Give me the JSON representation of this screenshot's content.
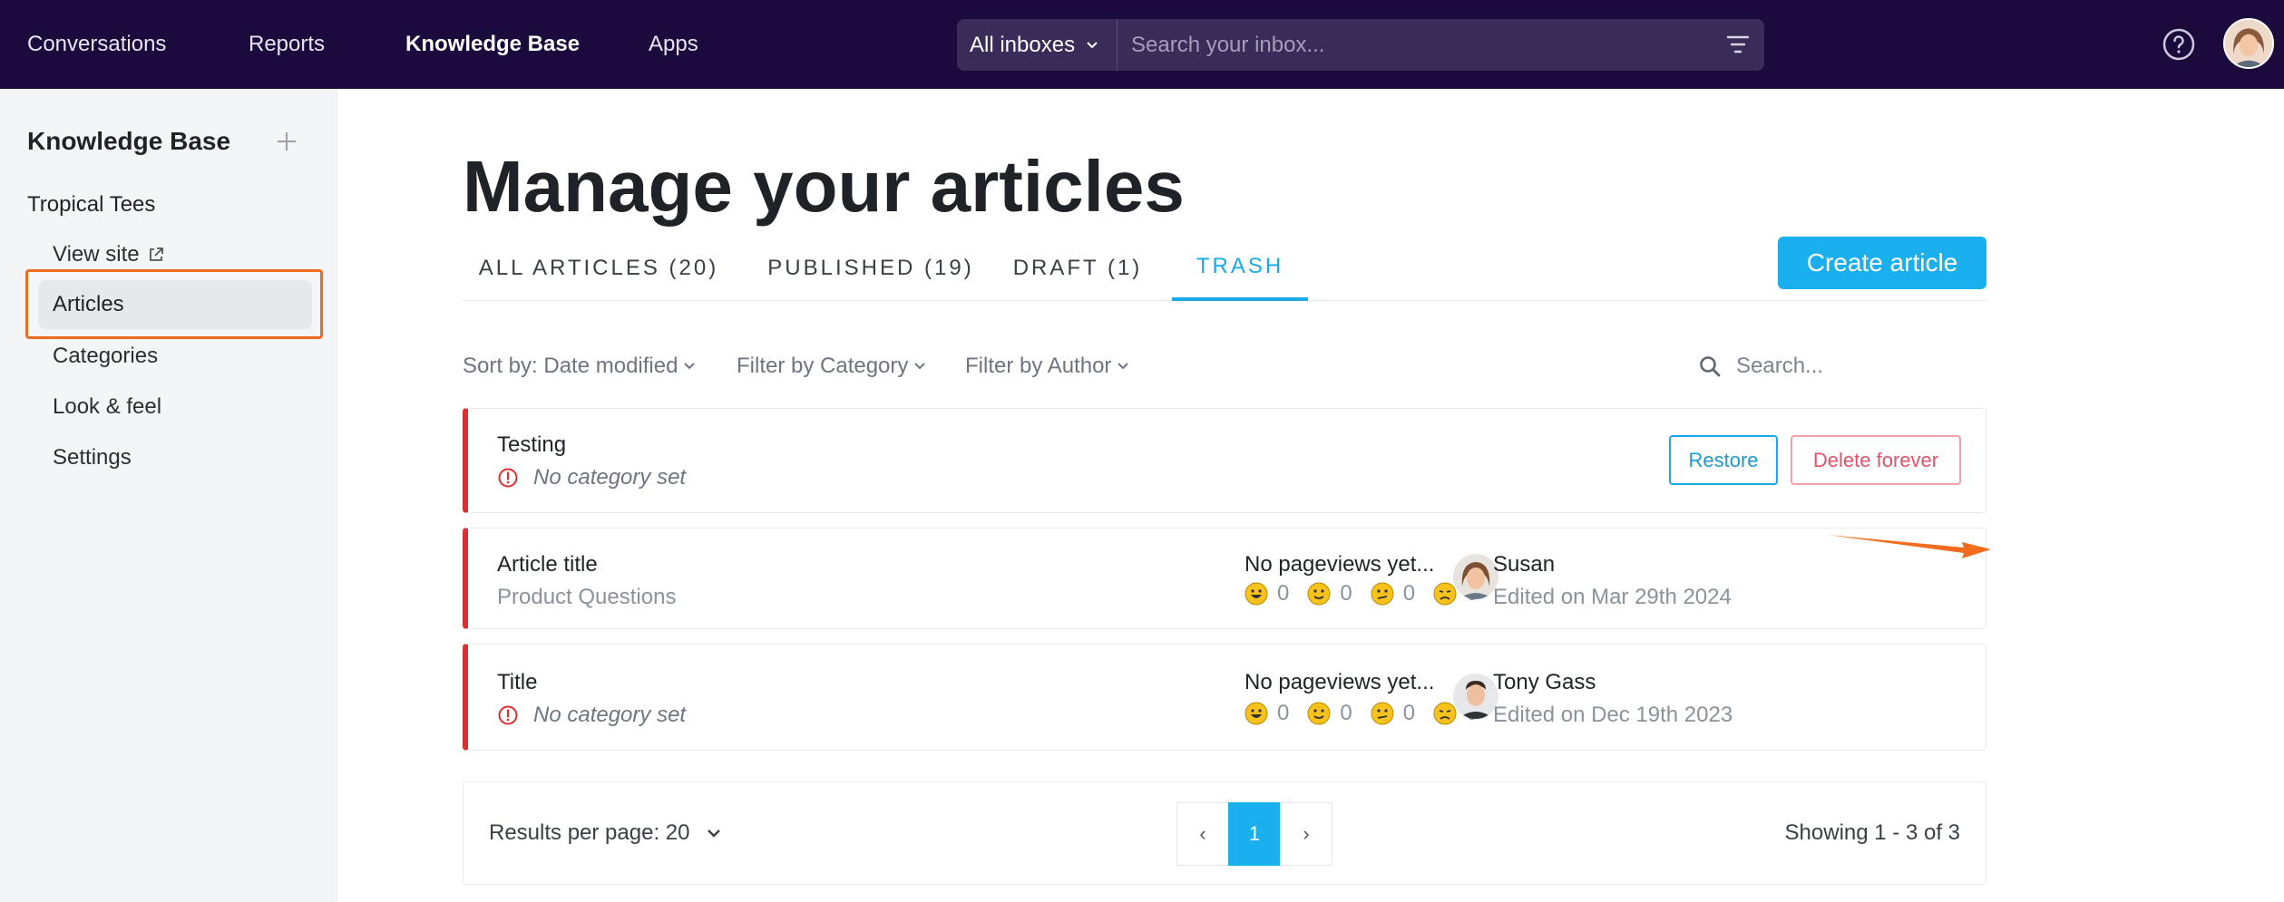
{
  "topnav": {
    "items": [
      {
        "label": "Conversations"
      },
      {
        "label": "Reports"
      },
      {
        "label": "Knowledge Base",
        "active": true
      },
      {
        "label": "Apps"
      }
    ],
    "inbox_select": "All inboxes",
    "search_placeholder": "Search your inbox..."
  },
  "sidebar": {
    "title": "Knowledge Base",
    "section": "Tropical Tees",
    "items": [
      {
        "label": "View site",
        "external": true
      },
      {
        "label": "Articles",
        "active": true
      },
      {
        "label": "Categories"
      },
      {
        "label": "Look & feel"
      },
      {
        "label": "Settings"
      }
    ]
  },
  "main": {
    "title": "Manage your articles",
    "tabs": [
      {
        "label": "ALL ARTICLES (20)"
      },
      {
        "label": "PUBLISHED (19)"
      },
      {
        "label": "DRAFT (1)"
      },
      {
        "label": "TRASH",
        "active": true
      }
    ],
    "create_button": "Create article",
    "filters": {
      "sort": "Sort by: Date modified",
      "category": "Filter by Category",
      "author": "Filter by Author",
      "search_placeholder": "Search..."
    },
    "rows": [
      {
        "title": "Testing",
        "category": "No category set",
        "category_missing": true,
        "restore": "Restore",
        "delete": "Delete forever"
      },
      {
        "title": "Article title",
        "category": "Product Questions",
        "pageviews": "No pageviews yet...",
        "reactions": [
          "0",
          "0",
          "0",
          "0"
        ],
        "author": "Susan",
        "edited": "Edited on Mar 29th 2024"
      },
      {
        "title": "Title",
        "category": "No category set",
        "category_missing": true,
        "pageviews": "No pageviews yet...",
        "reactions": [
          "0",
          "0",
          "0",
          "0"
        ],
        "author": "Tony Gass",
        "edited": "Edited on Dec 19th 2023"
      }
    ],
    "pagination": {
      "results_per_page": "Results per page: 20",
      "prev": "‹",
      "page": "1",
      "next": "›",
      "showing": "Showing 1 - 3 of 3"
    }
  },
  "colors": {
    "topbar": "#1b0a3c",
    "accent": "#1ab0f0",
    "trash_border": "#dc2f2f",
    "highlight": "#f26c1f"
  }
}
